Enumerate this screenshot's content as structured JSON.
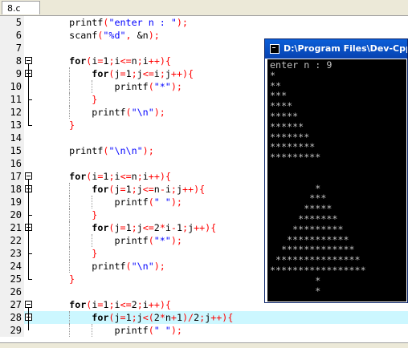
{
  "tab": {
    "label": "8.c"
  },
  "code_lines": [
    {
      "num": "5",
      "fold": false,
      "indent": 0,
      "highlight": false,
      "tokens": [
        {
          "t": "    ",
          "c": "pl"
        },
        {
          "t": "printf",
          "c": "pl"
        },
        {
          "t": "(",
          "c": "op"
        },
        {
          "t": "\"enter n : \"",
          "c": "str"
        },
        {
          "t": ");",
          "c": "op"
        }
      ]
    },
    {
      "num": "6",
      "fold": false,
      "indent": 0,
      "highlight": false,
      "tokens": [
        {
          "t": "    ",
          "c": "pl"
        },
        {
          "t": "scanf",
          "c": "pl"
        },
        {
          "t": "(",
          "c": "op"
        },
        {
          "t": "\"%d\"",
          "c": "str"
        },
        {
          "t": ", ",
          "c": "op"
        },
        {
          "t": "&n",
          "c": "pl"
        },
        {
          "t": ");",
          "c": "op"
        }
      ]
    },
    {
      "num": "7",
      "fold": false,
      "indent": 0,
      "highlight": false,
      "tokens": []
    },
    {
      "num": "8",
      "fold": true,
      "indent": 0,
      "highlight": false,
      "tokens": [
        {
          "t": "    ",
          "c": "pl"
        },
        {
          "t": "for",
          "c": "kw"
        },
        {
          "t": "(",
          "c": "op"
        },
        {
          "t": "i",
          "c": "pl"
        },
        {
          "t": "=",
          "c": "op"
        },
        {
          "t": "1",
          "c": "pl"
        },
        {
          "t": ";",
          "c": "op"
        },
        {
          "t": "i",
          "c": "pl"
        },
        {
          "t": "<=",
          "c": "op"
        },
        {
          "t": "n",
          "c": "pl"
        },
        {
          "t": ";",
          "c": "op"
        },
        {
          "t": "i",
          "c": "pl"
        },
        {
          "t": "++){",
          "c": "op"
        }
      ]
    },
    {
      "num": "9",
      "fold": true,
      "indent": 1,
      "highlight": false,
      "tokens": [
        {
          "t": "        ",
          "c": "pl"
        },
        {
          "t": "for",
          "c": "kw"
        },
        {
          "t": "(",
          "c": "op"
        },
        {
          "t": "j",
          "c": "pl"
        },
        {
          "t": "=",
          "c": "op"
        },
        {
          "t": "1",
          "c": "pl"
        },
        {
          "t": ";",
          "c": "op"
        },
        {
          "t": "j",
          "c": "pl"
        },
        {
          "t": "<=",
          "c": "op"
        },
        {
          "t": "i",
          "c": "pl"
        },
        {
          "t": ";",
          "c": "op"
        },
        {
          "t": "j",
          "c": "pl"
        },
        {
          "t": "++){",
          "c": "op"
        }
      ]
    },
    {
      "num": "10",
      "fold": false,
      "indent": 2,
      "highlight": false,
      "tokens": [
        {
          "t": "            ",
          "c": "pl"
        },
        {
          "t": "printf",
          "c": "pl"
        },
        {
          "t": "(",
          "c": "op"
        },
        {
          "t": "\"*\"",
          "c": "str"
        },
        {
          "t": ");",
          "c": "op"
        }
      ]
    },
    {
      "num": "11",
      "fold": false,
      "indent": 1,
      "highlight": false,
      "tokens": [
        {
          "t": "        ",
          "c": "pl"
        },
        {
          "t": "}",
          "c": "op"
        }
      ]
    },
    {
      "num": "12",
      "fold": false,
      "indent": 1,
      "highlight": false,
      "tokens": [
        {
          "t": "        ",
          "c": "pl"
        },
        {
          "t": "printf",
          "c": "pl"
        },
        {
          "t": "(",
          "c": "op"
        },
        {
          "t": "\"\\n\"",
          "c": "str"
        },
        {
          "t": ");",
          "c": "op"
        }
      ]
    },
    {
      "num": "13",
      "fold": false,
      "indent": 0,
      "highlight": false,
      "tokens": [
        {
          "t": "    ",
          "c": "pl"
        },
        {
          "t": "}",
          "c": "op"
        }
      ]
    },
    {
      "num": "14",
      "fold": false,
      "indent": 0,
      "highlight": false,
      "tokens": []
    },
    {
      "num": "15",
      "fold": false,
      "indent": 0,
      "highlight": false,
      "tokens": [
        {
          "t": "    ",
          "c": "pl"
        },
        {
          "t": "printf",
          "c": "pl"
        },
        {
          "t": "(",
          "c": "op"
        },
        {
          "t": "\"\\n\\n\"",
          "c": "str"
        },
        {
          "t": ");",
          "c": "op"
        }
      ]
    },
    {
      "num": "16",
      "fold": false,
      "indent": 0,
      "highlight": false,
      "tokens": []
    },
    {
      "num": "17",
      "fold": true,
      "indent": 0,
      "highlight": false,
      "tokens": [
        {
          "t": "    ",
          "c": "pl"
        },
        {
          "t": "for",
          "c": "kw"
        },
        {
          "t": "(",
          "c": "op"
        },
        {
          "t": "i",
          "c": "pl"
        },
        {
          "t": "=",
          "c": "op"
        },
        {
          "t": "1",
          "c": "pl"
        },
        {
          "t": ";",
          "c": "op"
        },
        {
          "t": "i",
          "c": "pl"
        },
        {
          "t": "<=",
          "c": "op"
        },
        {
          "t": "n",
          "c": "pl"
        },
        {
          "t": ";",
          "c": "op"
        },
        {
          "t": "i",
          "c": "pl"
        },
        {
          "t": "++){",
          "c": "op"
        }
      ]
    },
    {
      "num": "18",
      "fold": true,
      "indent": 1,
      "highlight": false,
      "tokens": [
        {
          "t": "        ",
          "c": "pl"
        },
        {
          "t": "for",
          "c": "kw"
        },
        {
          "t": "(",
          "c": "op"
        },
        {
          "t": "j",
          "c": "pl"
        },
        {
          "t": "=",
          "c": "op"
        },
        {
          "t": "1",
          "c": "pl"
        },
        {
          "t": ";",
          "c": "op"
        },
        {
          "t": "j",
          "c": "pl"
        },
        {
          "t": "<=",
          "c": "op"
        },
        {
          "t": "n",
          "c": "pl"
        },
        {
          "t": "-",
          "c": "op"
        },
        {
          "t": "i",
          "c": "pl"
        },
        {
          "t": ";",
          "c": "op"
        },
        {
          "t": "j",
          "c": "pl"
        },
        {
          "t": "++){",
          "c": "op"
        }
      ]
    },
    {
      "num": "19",
      "fold": false,
      "indent": 2,
      "highlight": false,
      "tokens": [
        {
          "t": "            ",
          "c": "pl"
        },
        {
          "t": "printf",
          "c": "pl"
        },
        {
          "t": "(",
          "c": "op"
        },
        {
          "t": "\" \"",
          "c": "str"
        },
        {
          "t": ");",
          "c": "op"
        }
      ]
    },
    {
      "num": "20",
      "fold": false,
      "indent": 1,
      "highlight": false,
      "tokens": [
        {
          "t": "        ",
          "c": "pl"
        },
        {
          "t": "}",
          "c": "op"
        }
      ]
    },
    {
      "num": "21",
      "fold": true,
      "indent": 1,
      "highlight": false,
      "tokens": [
        {
          "t": "        ",
          "c": "pl"
        },
        {
          "t": "for",
          "c": "kw"
        },
        {
          "t": "(",
          "c": "op"
        },
        {
          "t": "j",
          "c": "pl"
        },
        {
          "t": "=",
          "c": "op"
        },
        {
          "t": "1",
          "c": "pl"
        },
        {
          "t": ";",
          "c": "op"
        },
        {
          "t": "j",
          "c": "pl"
        },
        {
          "t": "<=",
          "c": "op"
        },
        {
          "t": "2",
          "c": "pl"
        },
        {
          "t": "*",
          "c": "op"
        },
        {
          "t": "i",
          "c": "pl"
        },
        {
          "t": "-",
          "c": "op"
        },
        {
          "t": "1",
          "c": "pl"
        },
        {
          "t": ";",
          "c": "op"
        },
        {
          "t": "j",
          "c": "pl"
        },
        {
          "t": "++){",
          "c": "op"
        }
      ]
    },
    {
      "num": "22",
      "fold": false,
      "indent": 2,
      "highlight": false,
      "tokens": [
        {
          "t": "            ",
          "c": "pl"
        },
        {
          "t": "printf",
          "c": "pl"
        },
        {
          "t": "(",
          "c": "op"
        },
        {
          "t": "\"*\"",
          "c": "str"
        },
        {
          "t": ");",
          "c": "op"
        }
      ]
    },
    {
      "num": "23",
      "fold": false,
      "indent": 1,
      "highlight": false,
      "tokens": [
        {
          "t": "        ",
          "c": "pl"
        },
        {
          "t": "}",
          "c": "op"
        }
      ]
    },
    {
      "num": "24",
      "fold": false,
      "indent": 1,
      "highlight": false,
      "tokens": [
        {
          "t": "        ",
          "c": "pl"
        },
        {
          "t": "printf",
          "c": "pl"
        },
        {
          "t": "(",
          "c": "op"
        },
        {
          "t": "\"\\n\"",
          "c": "str"
        },
        {
          "t": ");",
          "c": "op"
        }
      ]
    },
    {
      "num": "25",
      "fold": false,
      "indent": 0,
      "highlight": false,
      "tokens": [
        {
          "t": "    ",
          "c": "pl"
        },
        {
          "t": "}",
          "c": "op"
        }
      ]
    },
    {
      "num": "26",
      "fold": false,
      "indent": 0,
      "highlight": false,
      "tokens": []
    },
    {
      "num": "27",
      "fold": true,
      "indent": 0,
      "highlight": false,
      "tokens": [
        {
          "t": "    ",
          "c": "pl"
        },
        {
          "t": "for",
          "c": "kw"
        },
        {
          "t": "(",
          "c": "op"
        },
        {
          "t": "i",
          "c": "pl"
        },
        {
          "t": "=",
          "c": "op"
        },
        {
          "t": "1",
          "c": "pl"
        },
        {
          "t": ";",
          "c": "op"
        },
        {
          "t": "i",
          "c": "pl"
        },
        {
          "t": "<=",
          "c": "op"
        },
        {
          "t": "2",
          "c": "pl"
        },
        {
          "t": ";",
          "c": "op"
        },
        {
          "t": "i",
          "c": "pl"
        },
        {
          "t": "++){",
          "c": "op"
        }
      ]
    },
    {
      "num": "28",
      "fold": true,
      "indent": 1,
      "highlight": true,
      "tokens": [
        {
          "t": "        ",
          "c": "pl"
        },
        {
          "t": "for",
          "c": "kw"
        },
        {
          "t": "(",
          "c": "op"
        },
        {
          "t": "j",
          "c": "pl"
        },
        {
          "t": "=",
          "c": "op"
        },
        {
          "t": "1",
          "c": "pl"
        },
        {
          "t": ";",
          "c": "op"
        },
        {
          "t": "j",
          "c": "pl"
        },
        {
          "t": "<(",
          "c": "op"
        },
        {
          "t": "2",
          "c": "pl"
        },
        {
          "t": "*",
          "c": "op"
        },
        {
          "t": "n",
          "c": "pl"
        },
        {
          "t": "+",
          "c": "op"
        },
        {
          "t": "1",
          "c": "pl"
        },
        {
          "t": ")/",
          "c": "op"
        },
        {
          "t": "2",
          "c": "pl"
        },
        {
          "t": ";",
          "c": "op"
        },
        {
          "t": "j",
          "c": "pl"
        },
        {
          "t": "++){",
          "c": "op"
        }
      ]
    },
    {
      "num": "29",
      "fold": false,
      "indent": 2,
      "highlight": false,
      "tokens": [
        {
          "t": "            ",
          "c": "pl"
        },
        {
          "t": "printf",
          "c": "pl"
        },
        {
          "t": "(",
          "c": "op"
        },
        {
          "t": "\" \"",
          "c": "str"
        },
        {
          "t": ");",
          "c": "op"
        }
      ]
    }
  ],
  "console": {
    "title": "D:\\Program Files\\Dev-Cpp\\Co",
    "lines": [
      "enter n : 9",
      "*",
      "**",
      "***",
      "****",
      "*****",
      "******",
      "*******",
      "********",
      "*********",
      "",
      "",
      "        *",
      "       ***",
      "      *****",
      "     *******",
      "    *********",
      "   ***********",
      "  *************",
      " ***************",
      "*****************",
      "        *",
      "        *"
    ]
  },
  "colors": {
    "keyword": "#000000",
    "string": "#0000ff",
    "operator": "#ff0000",
    "current_line": "#ccf7ff",
    "console_bg": "#000000",
    "console_text": "#c0c0c0",
    "titlebar": "#0a5fd9"
  },
  "icons": {
    "fold": "fold-minus-icon",
    "console": "console-app-icon"
  }
}
